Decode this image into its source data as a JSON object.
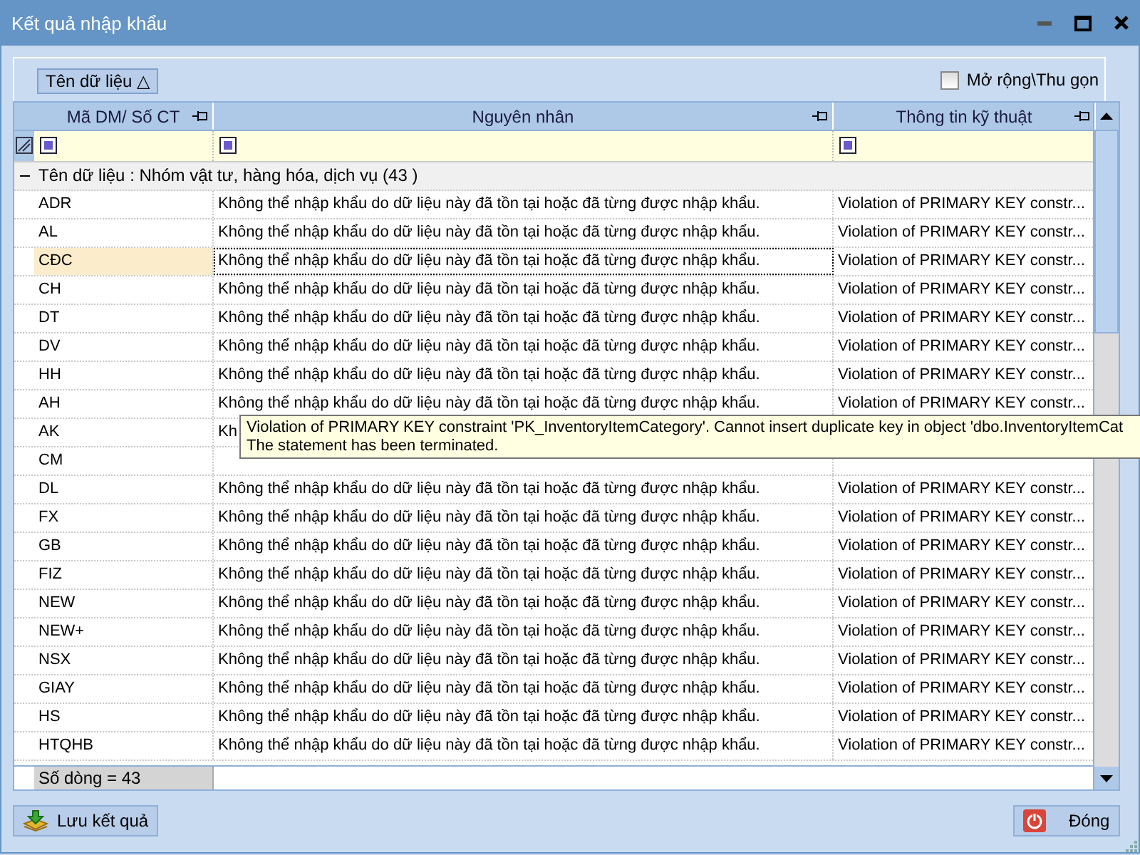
{
  "window": {
    "title": "Kết quả nhập khẩu"
  },
  "group_panel": {
    "group_chip": {
      "label": "Tên dữ liệu",
      "sort_glyph": "△"
    },
    "expand_toggle": {
      "label": "Mở rộng\\Thu gọn",
      "checked": false
    }
  },
  "grid": {
    "columns": [
      {
        "label": "Mã DM/ Số CT"
      },
      {
        "label": "Nguyên nhân"
      },
      {
        "label": "Thông tin kỹ thuật"
      }
    ],
    "group_row": {
      "label": "Tên dữ liệu : Nhóm vật tư, hàng hóa, dịch vụ (43 )",
      "expanded": true
    },
    "rows": [
      {
        "code": "ADR",
        "reason": "Không thể nhập khẩu do dữ liệu này đã tồn tại hoặc đã từng được nhập khẩu.",
        "technical_info": "Violation of PRIMARY KEY constr...",
        "selected": false
      },
      {
        "code": "AL",
        "reason": "Không thể nhập khẩu do dữ liệu này đã tồn tại hoặc đã từng được nhập khẩu.",
        "technical_info": "Violation of PRIMARY KEY constr...",
        "selected": false
      },
      {
        "code": "CĐC",
        "reason": "Không thể nhập khẩu do dữ liệu này đã tồn tại hoặc đã từng được nhập khẩu.",
        "technical_info": "Violation of PRIMARY KEY constr...",
        "selected": true
      },
      {
        "code": "CH",
        "reason": "Không thể nhập khẩu do dữ liệu này đã tồn tại hoặc đã từng được nhập khẩu.",
        "technical_info": "Violation of PRIMARY KEY constr...",
        "selected": false
      },
      {
        "code": "DT",
        "reason": "Không thể nhập khẩu do dữ liệu này đã tồn tại hoặc đã từng được nhập khẩu.",
        "technical_info": "Violation of PRIMARY KEY constr...",
        "selected": false
      },
      {
        "code": "DV",
        "reason": "Không thể nhập khẩu do dữ liệu này đã tồn tại hoặc đã từng được nhập khẩu.",
        "technical_info": "Violation of PRIMARY KEY constr...",
        "selected": false
      },
      {
        "code": "HH",
        "reason": "Không thể nhập khẩu do dữ liệu này đã tồn tại hoặc đã từng được nhập khẩu.",
        "technical_info": "Violation of PRIMARY KEY constr...",
        "selected": false
      },
      {
        "code": "AH",
        "reason": "Không thể nhập khẩu do dữ liệu này đã tồn tại hoặc đã từng được nhập khẩu.",
        "technical_info": "Violation of PRIMARY KEY constr...",
        "selected": false
      },
      {
        "code": "AK",
        "reason": "Kh",
        "selected": false
      },
      {
        "code": "CM",
        "selected": false
      },
      {
        "code": "DL",
        "reason": "Không thể nhập khẩu do dữ liệu này đã tồn tại hoặc đã từng được nhập khẩu.",
        "technical_info": "Violation of PRIMARY KEY constr...",
        "selected": false
      },
      {
        "code": "FX",
        "reason": "Không thể nhập khẩu do dữ liệu này đã tồn tại hoặc đã từng được nhập khẩu.",
        "technical_info": "Violation of PRIMARY KEY constr...",
        "selected": false
      },
      {
        "code": "GB",
        "reason": "Không thể nhập khẩu do dữ liệu này đã tồn tại hoặc đã từng được nhập khẩu.",
        "technical_info": "Violation of PRIMARY KEY constr...",
        "selected": false
      },
      {
        "code": "FIZ",
        "reason": "Không thể nhập khẩu do dữ liệu này đã tồn tại hoặc đã từng được nhập khẩu.",
        "technical_info": "Violation of PRIMARY KEY constr...",
        "selected": false
      },
      {
        "code": "NEW",
        "reason": "Không thể nhập khẩu do dữ liệu này đã tồn tại hoặc đã từng được nhập khẩu.",
        "technical_info": "Violation of PRIMARY KEY constr...",
        "selected": false
      },
      {
        "code": "NEW+",
        "reason": "Không thể nhập khẩu do dữ liệu này đã tồn tại hoặc đã từng được nhập khẩu.",
        "technical_info": "Violation of PRIMARY KEY constr...",
        "selected": false
      },
      {
        "code": "NSX",
        "reason": "Không thể nhập khẩu do dữ liệu này đã tồn tại hoặc đã từng được nhập khẩu.",
        "technical_info": "Violation of PRIMARY KEY constr...",
        "selected": false
      },
      {
        "code": "GIAY",
        "reason": "Không thể nhập khẩu do dữ liệu này đã tồn tại hoặc đã từng được nhập khẩu.",
        "technical_info": "Violation of PRIMARY KEY constr...",
        "selected": false
      },
      {
        "code": "HS",
        "reason": "Không thể nhập khẩu do dữ liệu này đã tồn tại hoặc đã từng được nhập khẩu.",
        "technical_info": "Violation of PRIMARY KEY constr...",
        "selected": false
      },
      {
        "code": "HTQHB",
        "reason": "Không thể nhập khẩu do dữ liệu này đã tồn tại hoặc đã từng được nhập khẩu.",
        "technical_info": "Violation of PRIMARY KEY constr...",
        "selected": false
      }
    ],
    "footer": "Số dòng = 43"
  },
  "tooltip": {
    "lines": [
      "Violation of PRIMARY KEY constraint 'PK_InventoryItemCategory'. Cannot insert duplicate key in object 'dbo.InventoryItemCat",
      "The statement has been terminated."
    ]
  },
  "buttons": [
    {
      "label": "Lưu kết quả",
      "kind": "save"
    },
    {
      "label": "Đóng",
      "kind": "close"
    }
  ]
}
